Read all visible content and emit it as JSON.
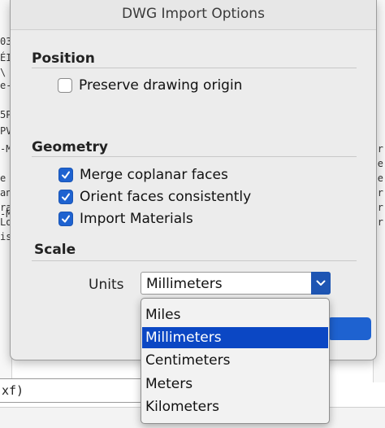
{
  "background": {
    "left_fragments": [
      "03",
      "ÉI",
      "\\",
      "e-M",
      "5P",
      "PV",
      "-M",
      "e",
      "an",
      "ra",
      "-M",
      "Lo",
      "is"
    ],
    "right_fragments": [
      "r",
      "e",
      "e",
      "r",
      "r",
      "r"
    ],
    "bottom_field_text": "xf)"
  },
  "dialog": {
    "title": "DWG Import Options",
    "position": {
      "heading": "Position",
      "preserve_origin": {
        "label": "Preserve drawing origin",
        "checked": false
      }
    },
    "geometry": {
      "heading": "Geometry",
      "options": [
        {
          "label": "Merge coplanar faces",
          "checked": true
        },
        {
          "label": "Orient faces consistently",
          "checked": true
        },
        {
          "label": "Import Materials",
          "checked": true
        }
      ]
    },
    "scale": {
      "heading": "Scale",
      "units_label": "Units",
      "selected": "Millimeters",
      "options": [
        "Miles",
        "Millimeters",
        "Centimeters",
        "Meters",
        "Kilometers"
      ]
    }
  },
  "colors": {
    "accent": "#1e62d0",
    "selection": "#0b47c4"
  }
}
